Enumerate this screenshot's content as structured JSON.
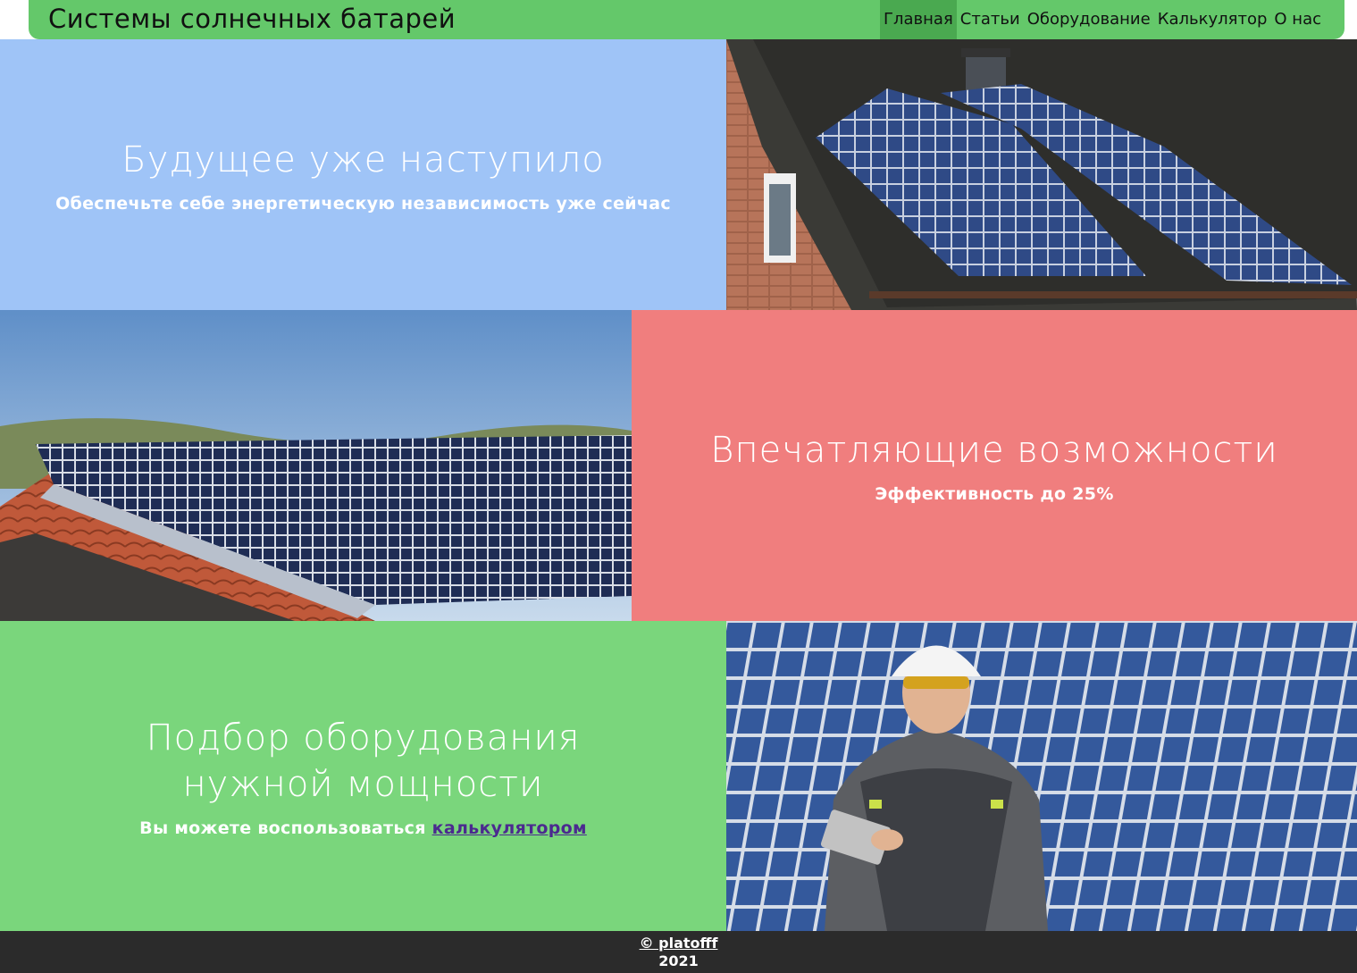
{
  "header": {
    "title": "Системы солнечных батарей",
    "nav": [
      "Главная",
      "Статьи",
      "Оборудование",
      "Калькулятор",
      "О нас"
    ],
    "active": "Главная"
  },
  "sections": {
    "future": {
      "heading": "Будущее уже наступило",
      "sub": "Обеспечьте себе энергетическую независимость уже сейчас"
    },
    "capabilities": {
      "heading": "Впечатляющие возможности",
      "sub": "Эффективность до 25%"
    },
    "selection": {
      "heading": "Подбор оборудования нужной мощности",
      "sub_prefix": "Вы можете воспользоваться ",
      "link": "калькулятором"
    }
  },
  "footer": {
    "copyright": "© platofff",
    "year": "2021"
  },
  "colors": {
    "header": "#64c86a",
    "nav_active": "#4aa950",
    "blue_panel": "#9fc4f7",
    "red_panel": "#f07e7e",
    "green_panel": "#7ad67c",
    "footer": "#2b2b2b"
  },
  "images": [
    "house-roof-solar-photo",
    "tiled-roof-solar-array-photo",
    "engineer-with-tablet-photo"
  ]
}
